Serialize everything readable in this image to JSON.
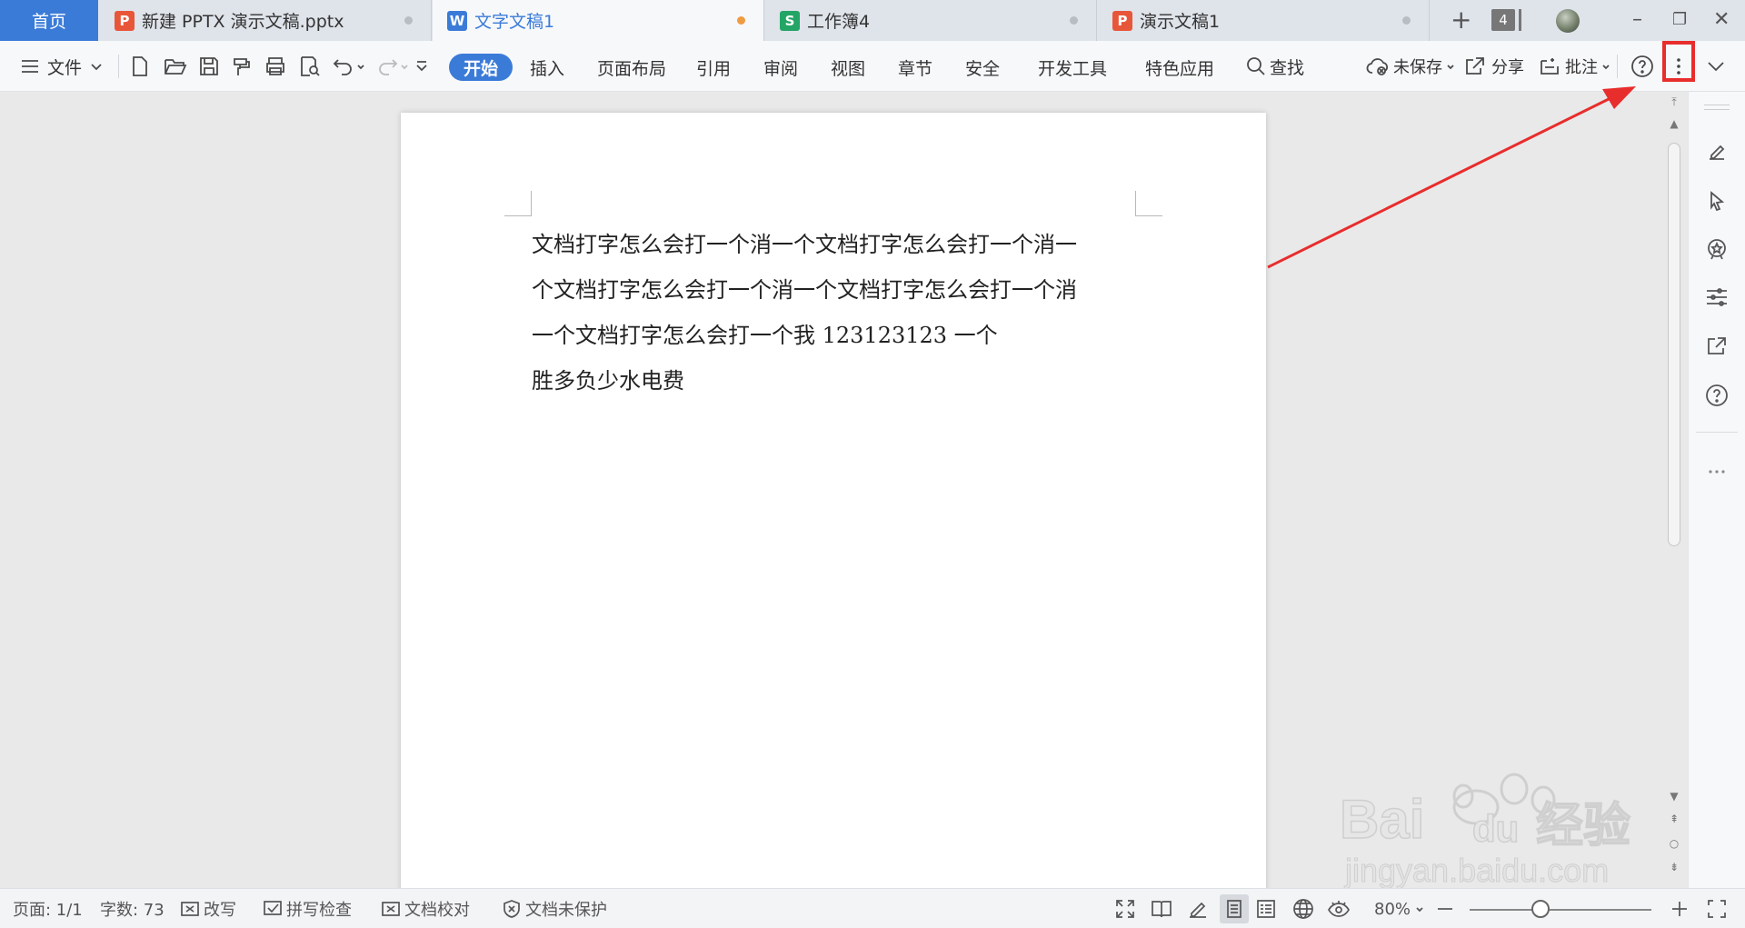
{
  "tabbar": {
    "home": "首页",
    "tabs": [
      {
        "label": "新建 PPTX 演示文稿.pptx",
        "icon": "P",
        "kind": "presentation"
      },
      {
        "label": "文字文稿1",
        "icon": "W",
        "kind": "writer"
      },
      {
        "label": "工作簿4",
        "icon": "S",
        "kind": "spreadsheet"
      },
      {
        "label": "演示文稿1",
        "icon": "P",
        "kind": "presentation"
      }
    ],
    "tab_count": "4"
  },
  "toolbar": {
    "file_menu": "文件",
    "tabs": [
      "开始",
      "插入",
      "页面布局",
      "引用",
      "审阅",
      "视图",
      "章节",
      "安全",
      "开发工具",
      "特色应用"
    ],
    "search": "查找",
    "unsaved": "未保存",
    "share": "分享",
    "comment": "批注"
  },
  "document": {
    "lines": [
      "文档打字怎么会打一个消一个文档打字怎么会打一个消一",
      "个文档打字怎么会打一个消一个文档打字怎么会打一个消",
      "一个文档打字怎么会打一个我 123123123 一个",
      "胜多负少水电费"
    ]
  },
  "statusbar": {
    "page": "页面: 1/1",
    "word_count": "字数: 73",
    "revise": "改写",
    "spellcheck": "拼写检查",
    "proofread": "文档校对",
    "protect": "文档未保护",
    "zoom": "80%"
  },
  "watermark": {
    "brand": "Bai",
    "brand2": "du",
    "cn": "经验",
    "url": "jingyan.baidu.com"
  },
  "colors": {
    "accent": "#3b7bd8",
    "highlight": "#e82d2d",
    "modified_dot": "#f09a42"
  }
}
